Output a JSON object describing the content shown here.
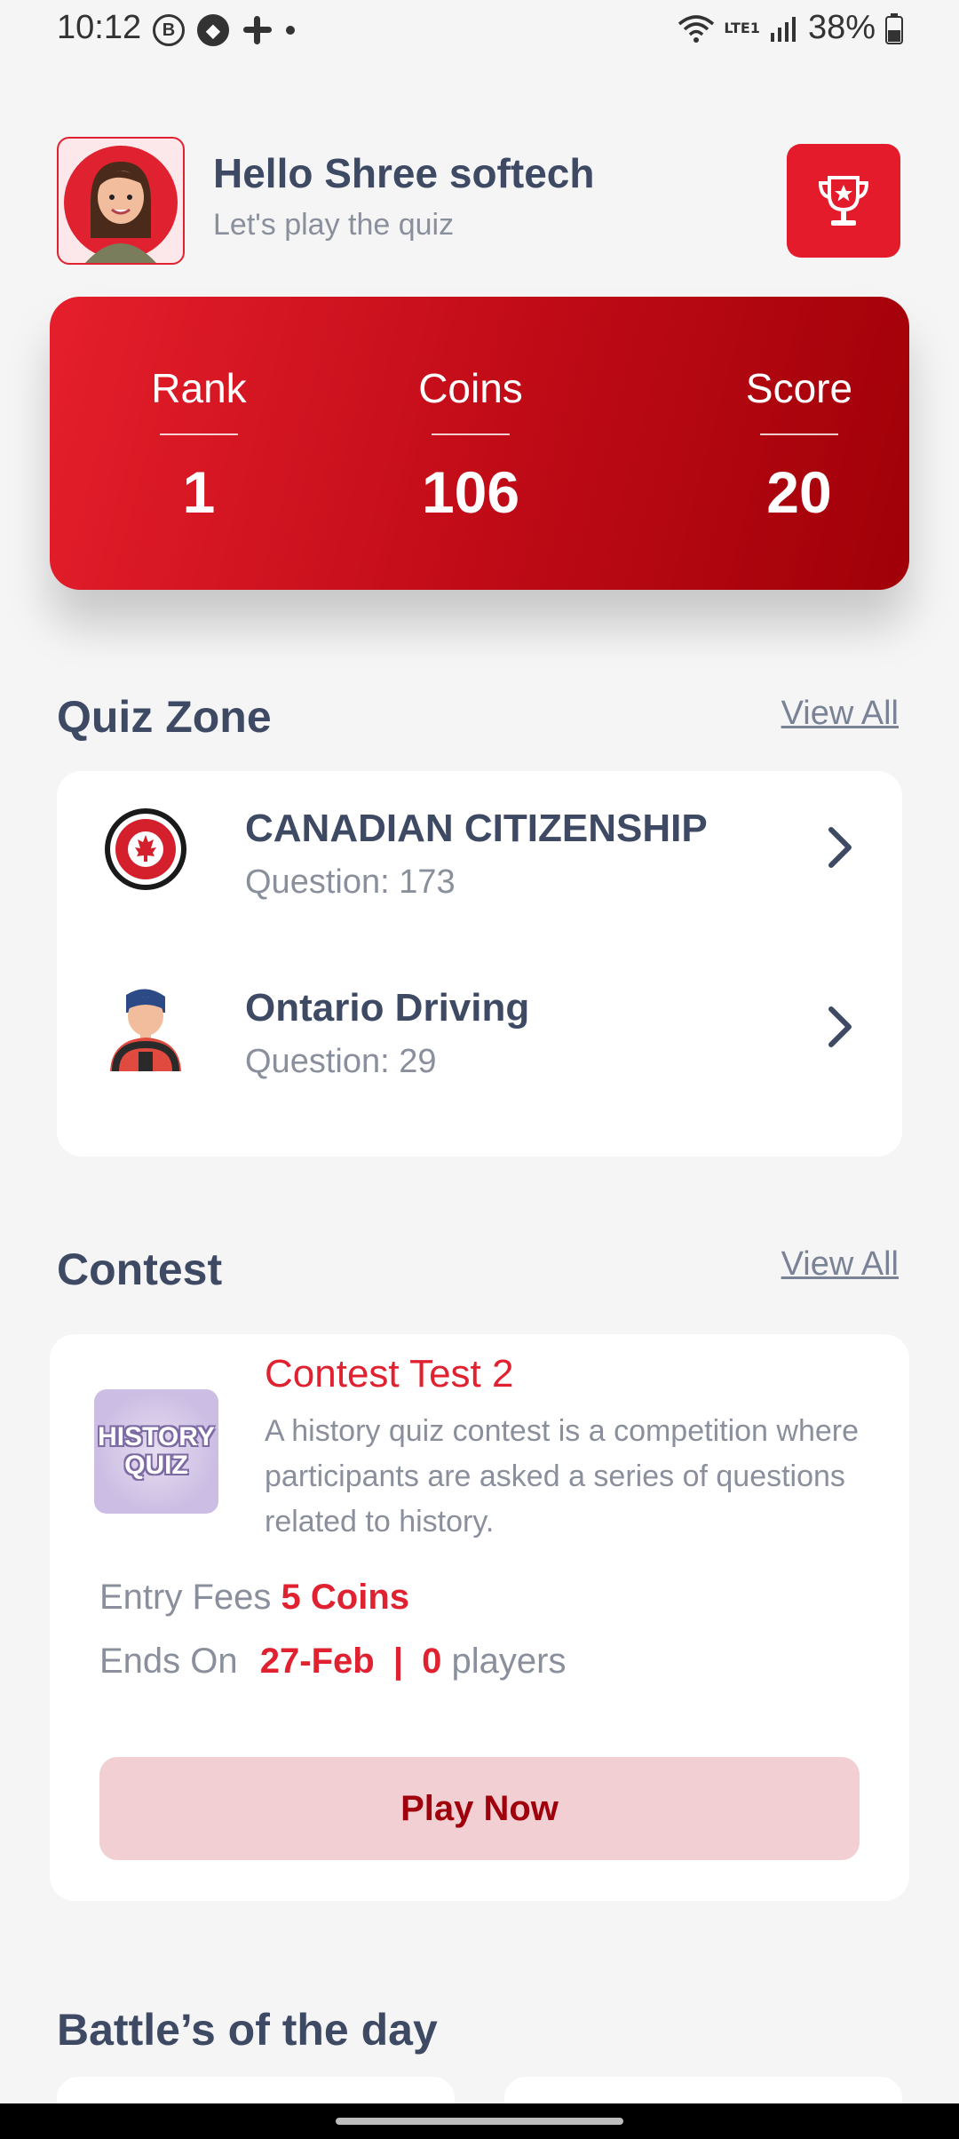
{
  "status_bar": {
    "time": "10:12",
    "battery": "38%",
    "network": "LTE1",
    "icons": [
      "b-badge-icon",
      "game-icon",
      "slack-icon",
      "dot-icon",
      "wifi-icon",
      "signal-icon",
      "battery-icon"
    ]
  },
  "header": {
    "greeting": "Hello Shree softech",
    "subtitle": "Let's play the quiz",
    "trophy_icon": "trophy-icon"
  },
  "stats": {
    "rank_label": "Rank",
    "rank_value": "1",
    "coins_label": "Coins",
    "coins_value": "106",
    "score_label": "Score",
    "score_value": "20"
  },
  "quiz_zone": {
    "title": "Quiz Zone",
    "view_all": "View All",
    "items": [
      {
        "name": "CANADIAN CITIZENSHIP",
        "count": "Question: 173",
        "icon": "canada-citizenship-badge-icon"
      },
      {
        "name": "Ontario Driving",
        "count": "Question: 29",
        "icon": "driver-icon"
      }
    ]
  },
  "contest": {
    "title": "Contest",
    "view_all": "View All",
    "card": {
      "thumb_text": "HISTORY QUIZ",
      "name": "Contest Test 2",
      "description": "A history quiz contest is a competition where participants are asked a series of questions related to history.",
      "entry_label": "Entry Fees",
      "entry_value": "5 Coins",
      "ends_label": "Ends On",
      "ends_date": "27-Feb",
      "separator": "|",
      "players_count": "0",
      "players_label": "players",
      "play_button": "Play Now"
    }
  },
  "battles": {
    "title": "Battle’s of the day"
  },
  "colors": {
    "accent": "#e0212f",
    "text_dark": "#3e4a63",
    "text_muted": "#8a8f9c",
    "background": "#f5f5f6"
  }
}
